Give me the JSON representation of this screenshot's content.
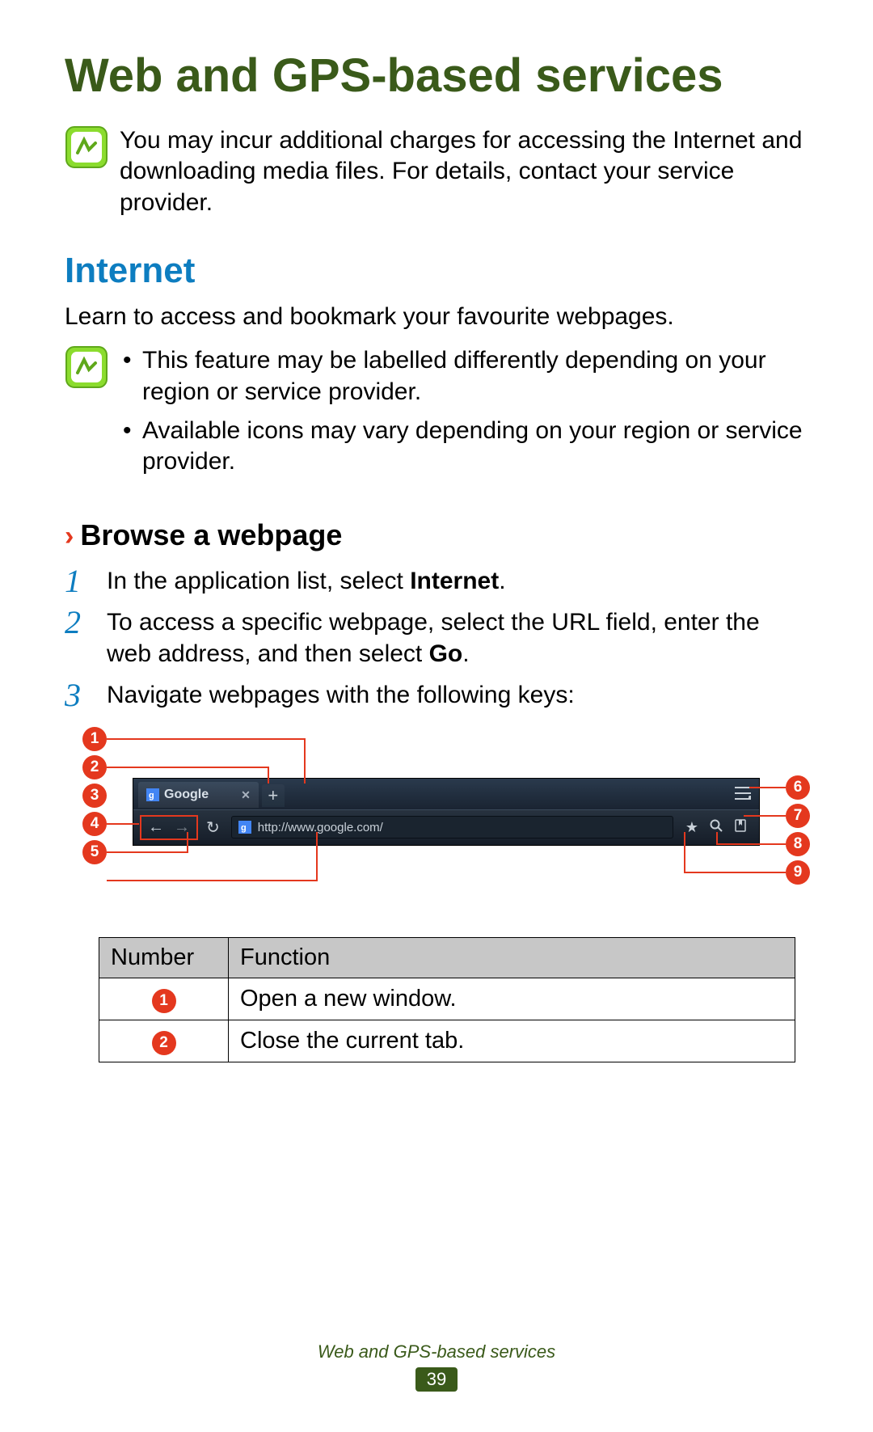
{
  "title": "Web and GPS-based services",
  "note1": "You may incur additional charges for accessing the Internet and downloading media files. For details, contact your service provider.",
  "section_internet": {
    "heading": "Internet",
    "intro": "Learn to access and bookmark your favourite webpages.",
    "notes": [
      "This feature may be labelled differently depending on your region or service provider.",
      "Available icons may vary depending on your region or service provider."
    ]
  },
  "subsection": {
    "chevron": "›",
    "title": "Browse a webpage"
  },
  "steps": [
    {
      "num": "1",
      "pre": "In the application list, select ",
      "bold": "Internet",
      "post": "."
    },
    {
      "num": "2",
      "pre": "To access a specific webpage, select the URL field, enter the web address, and then select ",
      "bold": "Go",
      "post": "."
    },
    {
      "num": "3",
      "pre": "Navigate webpages with the following keys:",
      "bold": "",
      "post": ""
    }
  ],
  "browser": {
    "tab_label": "Google",
    "url": "http://www.google.com/"
  },
  "callouts_left": [
    "1",
    "2",
    "3",
    "4",
    "5"
  ],
  "callouts_right": [
    "6",
    "7",
    "8",
    "9"
  ],
  "table": {
    "headers": [
      "Number",
      "Function"
    ],
    "rows": [
      {
        "num": "1",
        "func": "Open a new window."
      },
      {
        "num": "2",
        "func": "Close the current tab."
      }
    ]
  },
  "footer": {
    "title": "Web and GPS-based services",
    "page": "39"
  }
}
